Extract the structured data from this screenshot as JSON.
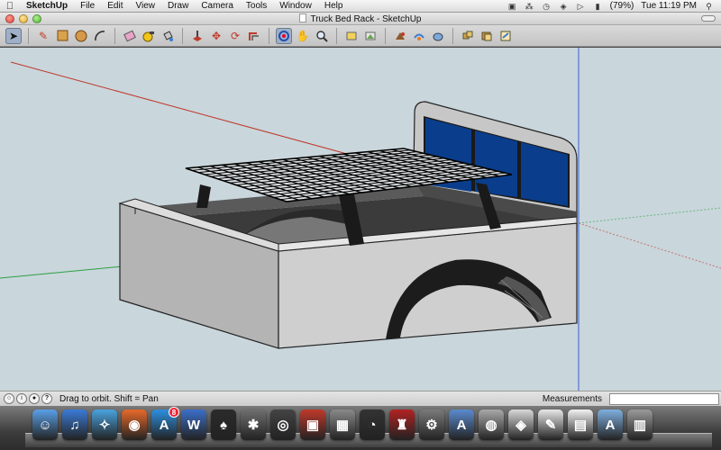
{
  "menubar": {
    "apple": "",
    "app_name": "SketchUp",
    "items": [
      "File",
      "Edit",
      "View",
      "Draw",
      "Camera",
      "Tools",
      "Window",
      "Help"
    ],
    "battery": "(79%)",
    "clock": "Tue 11:19 PM"
  },
  "window": {
    "title": "Truck Bed Rack - SketchUp"
  },
  "toolbar": {
    "tools": [
      "select-tool-icon",
      "pencil-icon",
      "rectangle-icon",
      "circle-icon",
      "arc-icon",
      "eraser-icon",
      "tape-measure-icon",
      "paint-bucket-icon",
      "push-pull-icon",
      "move-icon",
      "rotate-icon",
      "offset-icon",
      "orbit-icon",
      "pan-icon",
      "zoom-icon",
      "zoom-extents-icon",
      "previous-view-icon",
      "next-view-icon",
      "follow-me-icon",
      "get-models-icon",
      "share-model-icon",
      "components-icon"
    ]
  },
  "status": {
    "text": "Drag to orbit.  Shift = Pan",
    "measurements_label": "Measurements",
    "measurements_value": ""
  },
  "colors": {
    "sky": "#c9d6dc",
    "glass": "#0a3e8c",
    "body": "#c9c9c9",
    "rack": "#111111",
    "axis_red": "#c0392b",
    "axis_green": "#2ea043",
    "axis_blue": "#3b5cd9"
  },
  "dock": {
    "apps": [
      {
        "name": "finder",
        "badge": ""
      },
      {
        "name": "itunes",
        "badge": ""
      },
      {
        "name": "safari",
        "badge": ""
      },
      {
        "name": "firefox",
        "badge": ""
      },
      {
        "name": "app-store",
        "badge": "8"
      },
      {
        "name": "word",
        "badge": ""
      },
      {
        "name": "solitaire",
        "badge": ""
      },
      {
        "name": "bug-app",
        "badge": ""
      },
      {
        "name": "camera",
        "badge": ""
      },
      {
        "name": "photo-booth",
        "badge": ""
      },
      {
        "name": "preview",
        "badge": ""
      },
      {
        "name": "time-machine",
        "badge": ""
      },
      {
        "name": "sketchup-chair",
        "badge": ""
      },
      {
        "name": "system-preferences",
        "badge": ""
      },
      {
        "name": "font-app",
        "badge": ""
      },
      {
        "name": "bucket-app",
        "badge": ""
      },
      {
        "name": "photo-app",
        "badge": ""
      },
      {
        "name": "text-edit",
        "badge": ""
      },
      {
        "name": "document",
        "badge": ""
      },
      {
        "name": "applications-folder",
        "badge": ""
      },
      {
        "name": "trash",
        "badge": ""
      }
    ]
  }
}
